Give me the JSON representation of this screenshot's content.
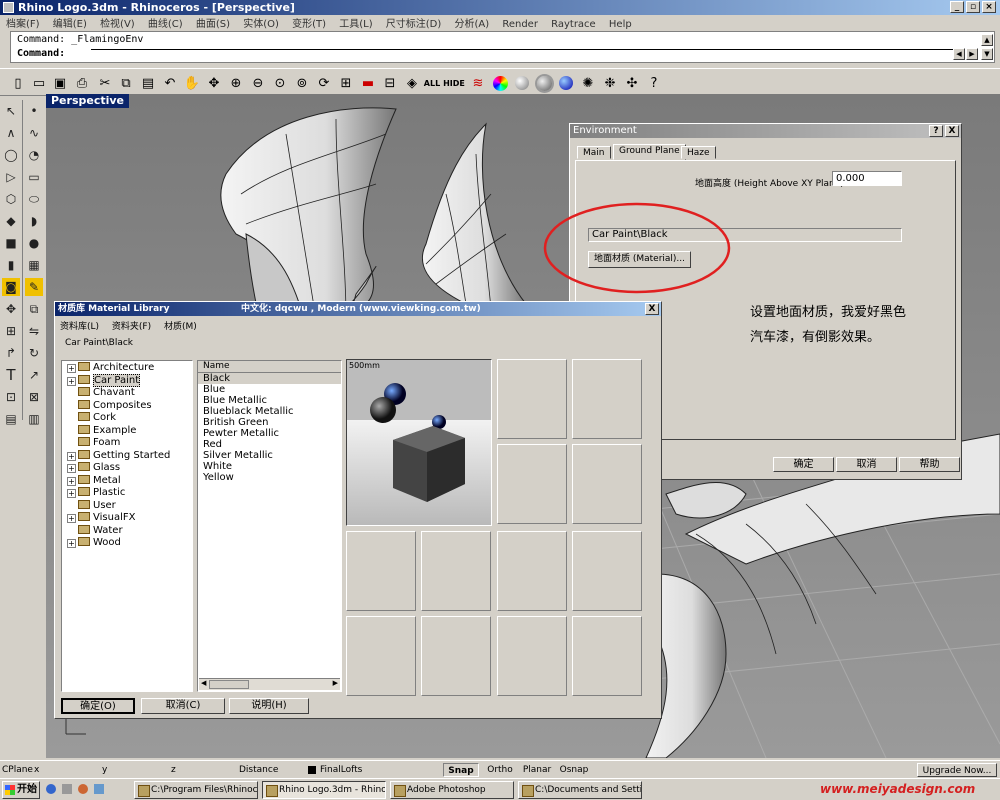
{
  "window": {
    "title": "Rhino Logo.3dm - Rhinoceros - [Perspective]"
  },
  "menu": [
    "档案(F)",
    "编辑(E)",
    "检视(V)",
    "曲线(C)",
    "曲面(S)",
    "实体(O)",
    "变形(T)",
    "工具(L)",
    "尺寸标注(D)",
    "分析(A)",
    "Render",
    "Raytrace",
    "Help"
  ],
  "command": {
    "history": "Command: _FlamingoEnv",
    "prompt": "Command:"
  },
  "toolbar_text": {
    "all_label": "ALL",
    "hide_label": "HIDE"
  },
  "left_tool_label": "T",
  "viewport": {
    "name": "Perspective"
  },
  "environment": {
    "title": "Environment",
    "help_btn": "?",
    "close_btn": "X",
    "tabs": [
      "Main",
      "Ground Plane",
      "Haze"
    ],
    "height_label": "地面高度 (Height Above XY Plane):",
    "height_value": "0.000",
    "material_value": "Car Paint\\Black",
    "material_button": "地面材质 (Material)...",
    "annotation_line1": "设置地面材质，我爱好黑色",
    "annotation_line2": "汽车漆，有倒影效果。",
    "ok": "确定",
    "cancel": "取消",
    "help": "帮助"
  },
  "material_library": {
    "title": "材质库    Material Library",
    "title_credit": "中文化: dqcwu , Modern  (www.viewking.com.tw)",
    "close_btn": "X",
    "menu": [
      "资料库(L)",
      "资料夹(F)",
      "材质(M)"
    ],
    "path": "Car Paint\\Black",
    "tree": [
      {
        "label": "Architecture",
        "expand": true
      },
      {
        "label": "Car Paint",
        "expand": true
      },
      {
        "label": "Chavant",
        "expand": false
      },
      {
        "label": "Composites",
        "expand": false
      },
      {
        "label": "Cork",
        "expand": false
      },
      {
        "label": "Example",
        "expand": false
      },
      {
        "label": "Foam",
        "expand": false
      },
      {
        "label": "Getting Started",
        "expand": true
      },
      {
        "label": "Glass",
        "expand": true
      },
      {
        "label": "Metal",
        "expand": true
      },
      {
        "label": "Plastic",
        "expand": true
      },
      {
        "label": "User",
        "expand": false
      },
      {
        "label": "VisualFX",
        "expand": true
      },
      {
        "label": "Water",
        "expand": false
      },
      {
        "label": "Wood",
        "expand": true
      }
    ],
    "list_header": "Name",
    "materials": [
      "Black",
      "Blue",
      "Blue Metallic",
      "Blueblack Metallic",
      "British Green",
      "Pewter Metallic",
      "Red",
      "Silver Metallic",
      "White",
      "Yellow"
    ],
    "preview_label": "500mm",
    "ok": "确定(O)",
    "cancel": "取消(C)",
    "help": "说明(H)"
  },
  "statusbar": {
    "cplane": "CPlane",
    "x": "x",
    "y": "y",
    "z": "z",
    "distance": "Distance",
    "layer": "FinalLofts",
    "snap": "Snap",
    "ortho": "Ortho",
    "planar": "Planar",
    "osnap": "Osnap",
    "upgrade": "Upgrade Now..."
  },
  "taskbar": {
    "start": "开始",
    "tasks": [
      "C:\\Program Files\\Rhinoc...",
      "Rhino Logo.3dm - Rhinoc...",
      "Adobe Photoshop",
      "C:\\Documents and Settin..."
    ],
    "watermark": "www.meiyadesign.com"
  }
}
